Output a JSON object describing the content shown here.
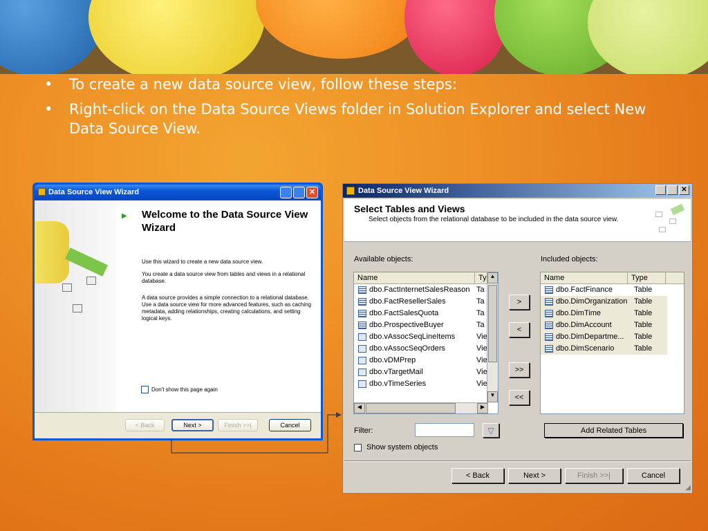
{
  "slide": {
    "bullets": [
      "To create a new data source view, follow these steps:",
      "Right-click on the Data Source Views folder in Solution Explorer and select New Data Source View."
    ]
  },
  "wizard1": {
    "title": "Data Source View Wizard",
    "heading": "Welcome to the Data Source View Wizard",
    "para1": "Use this wizard to create a new data source view.",
    "para2": "You create a data source view from tables and views in a relational database.",
    "para3": "A data source provides a simple connection to a relational database. Use a data source view for more advanced features, such as caching metadata, adding relationships, creating calculations, and setting logical keys.",
    "dont_show": "Don't show this page again",
    "back": "< Back",
    "next": "Next >",
    "finish": "Finish >>|",
    "cancel": "Cancel"
  },
  "wizard2": {
    "title": "Data Source View Wizard",
    "heading": "Select Tables and Views",
    "subheading": "Select objects from the relational database to be included in the data source view.",
    "available_label": "Available objects:",
    "included_label": "Included objects:",
    "col_name": "Name",
    "col_type_short": "Ty",
    "col_type": "Type",
    "available": [
      {
        "name": "dbo.FactInternetSalesReason",
        "type": "Ta",
        "kind": "table"
      },
      {
        "name": "dbo.FactResellerSales",
        "type": "Ta",
        "kind": "table"
      },
      {
        "name": "dbo.FactSalesQuota",
        "type": "Ta",
        "kind": "table"
      },
      {
        "name": "dbo.ProspectiveBuyer",
        "type": "Ta",
        "kind": "table"
      },
      {
        "name": "dbo.vAssocSeqLineItems",
        "type": "Vie",
        "kind": "view"
      },
      {
        "name": "dbo.vAssocSeqOrders",
        "type": "Vie",
        "kind": "view"
      },
      {
        "name": "dbo.vDMPrep",
        "type": "Vie",
        "kind": "view"
      },
      {
        "name": "dbo.vTargetMail",
        "type": "Vie",
        "kind": "view"
      },
      {
        "name": "dbo.vTimeSeries",
        "type": "Vie",
        "kind": "view"
      }
    ],
    "included": [
      {
        "name": "dbo.FactFinance",
        "type": "Table"
      },
      {
        "name": "dbo.DimOrganization",
        "type": "Table"
      },
      {
        "name": "dbo.DimTime",
        "type": "Table"
      },
      {
        "name": "dbo.DimAccount",
        "type": "Table"
      },
      {
        "name": "dbo.DimDepartme...",
        "type": "Table"
      },
      {
        "name": "dbo.DimScenario",
        "type": "Table"
      }
    ],
    "move_right": ">",
    "move_left": "<",
    "move_all_right": ">>",
    "move_all_left": "<<",
    "filter_label": "Filter:",
    "filter_value": "",
    "show_system": "Show system objects",
    "add_related": "Add Related Tables",
    "back": "< Back",
    "next": "Next >",
    "finish": "Finish >>|",
    "cancel": "Cancel"
  }
}
